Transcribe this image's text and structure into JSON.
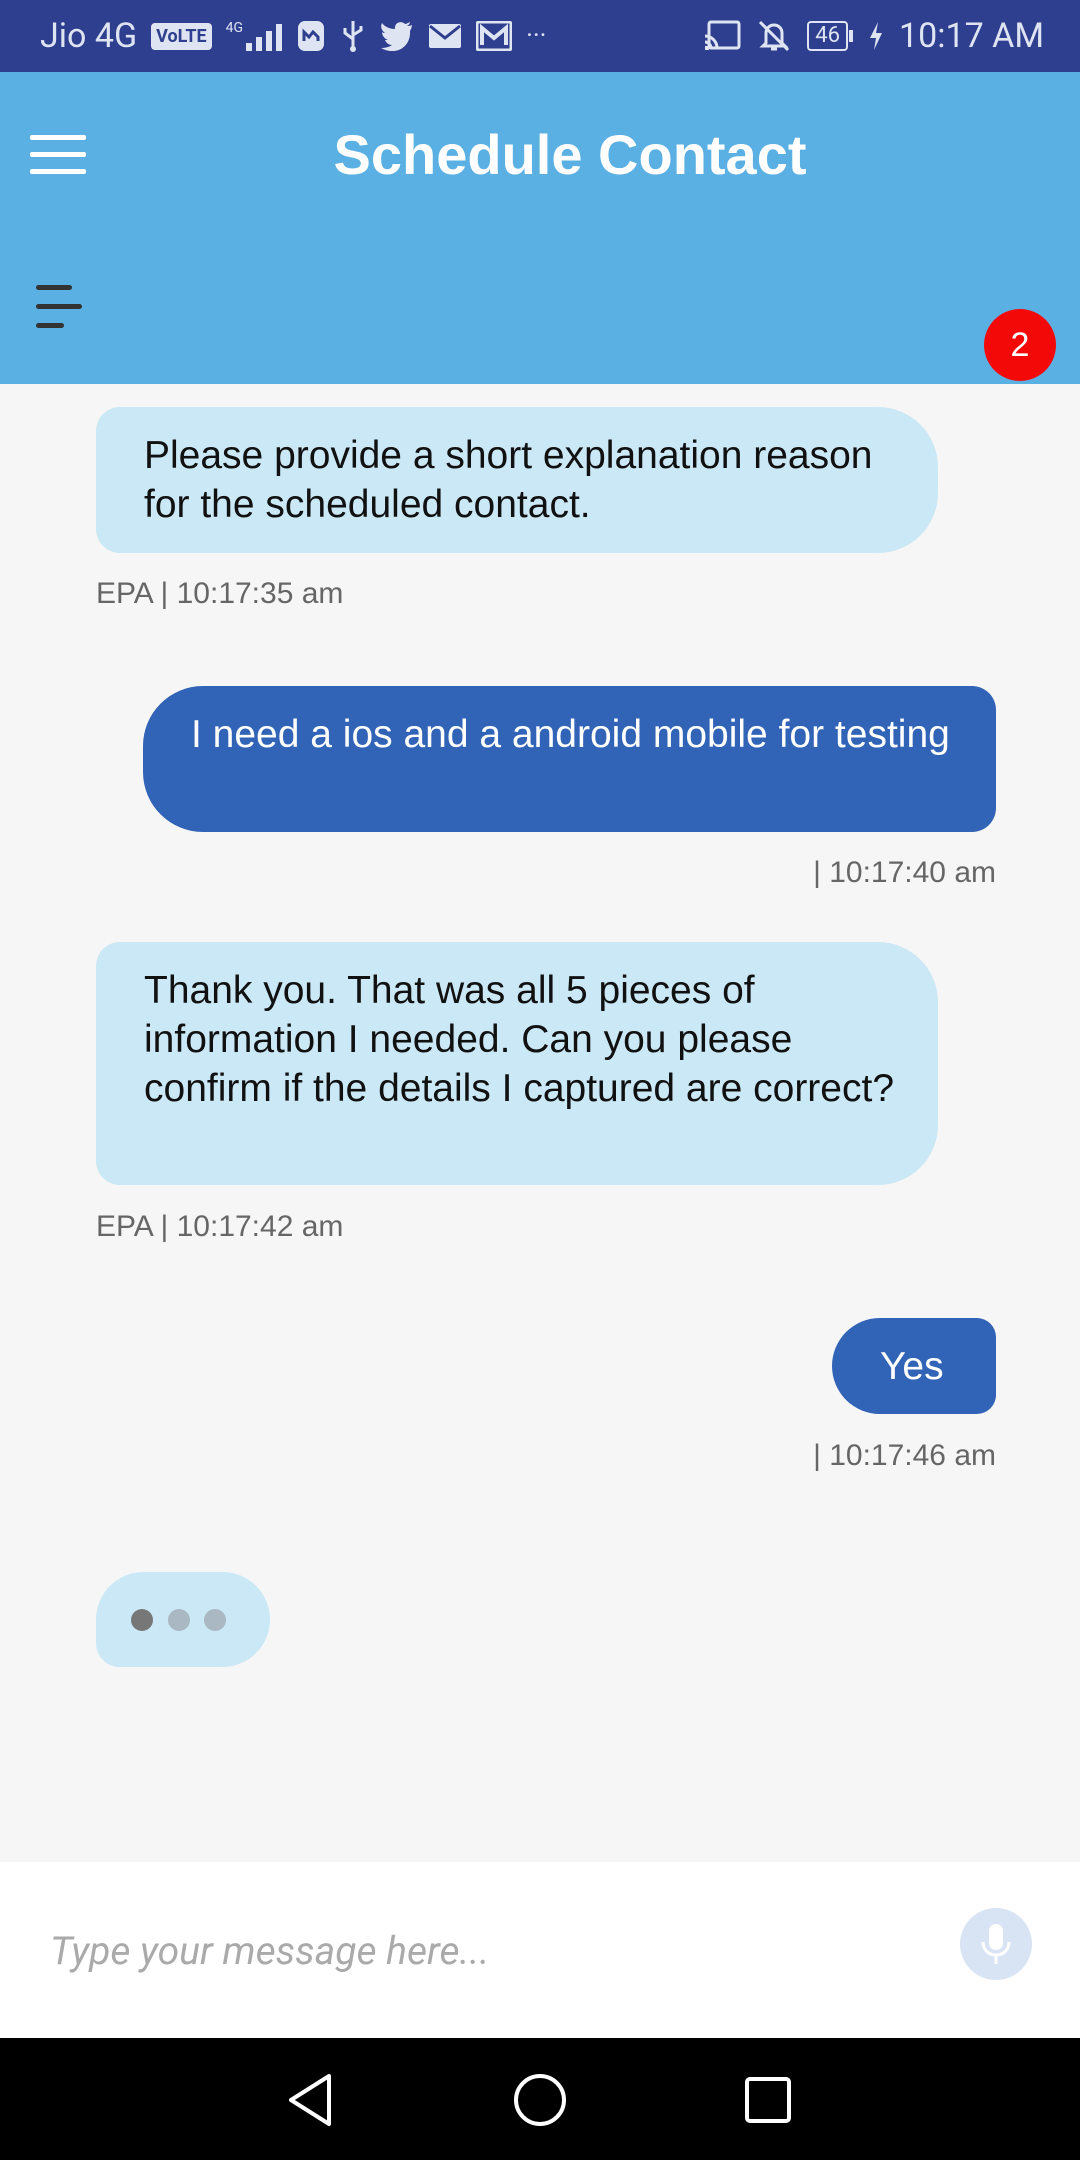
{
  "status_bar": {
    "carrier": "Jio 4G",
    "volte": "VoLTE",
    "network": "4G",
    "battery": "46",
    "time": "10:17 AM",
    "more": "···"
  },
  "header": {
    "title": "Schedule Contact",
    "badge_count": "2"
  },
  "messages": [
    {
      "from": "bot",
      "text": "Please provide a short explanation reason for the scheduled contact.",
      "meta": "EPA | 10:17:35 am"
    },
    {
      "from": "user",
      "text": "I need a ios and a android mobile for testing",
      "meta": "| 10:17:40 am"
    },
    {
      "from": "bot",
      "text": "Thank you. That was all 5 pieces of information I needed. Can you please confirm if the details I captured are correct?",
      "meta": "EPA | 10:17:42 am"
    },
    {
      "from": "user",
      "text": "Yes",
      "meta": "| 10:17:46 am"
    }
  ],
  "input": {
    "placeholder": "Type your message here..."
  },
  "colors": {
    "header_bg": "#5ab0e2",
    "bot_bubble": "#cbe8f6",
    "user_bubble": "#3163b7",
    "badge": "#f40909",
    "status_bar": "#2f3f8f"
  }
}
